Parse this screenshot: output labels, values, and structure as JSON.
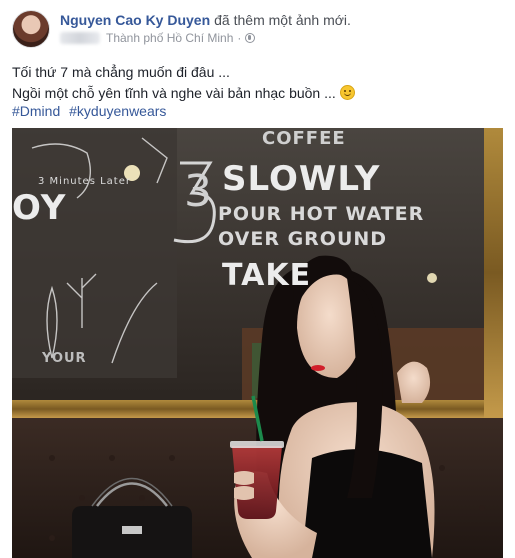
{
  "post": {
    "author": "Nguyen Cao Ky Duyen",
    "action": "đã thêm một ảnh mới.",
    "location": "Thành phố Hồ Chí Minh",
    "separator": "·",
    "privacy_icon": "globe-icon",
    "text_lines": [
      "Tối thứ 7 mà chẳng muốn đi đâu ...",
      "Ngồi một chỗ yên tĩnh và nghe vài bản nhạc buồn ..."
    ],
    "emoji": "smiley-icon",
    "hashtags": [
      "#Dmind",
      "#kyduyenwears"
    ]
  },
  "photo_signage": {
    "slowly": "SLOWLY",
    "pour": "POUR HOT WATER",
    "over": "OVER GROUND",
    "take": "TAKE",
    "top": "COFFEE",
    "three": "3",
    "oy": "OY",
    "minute": "3 Minutes Later",
    "your": "YOUR"
  }
}
